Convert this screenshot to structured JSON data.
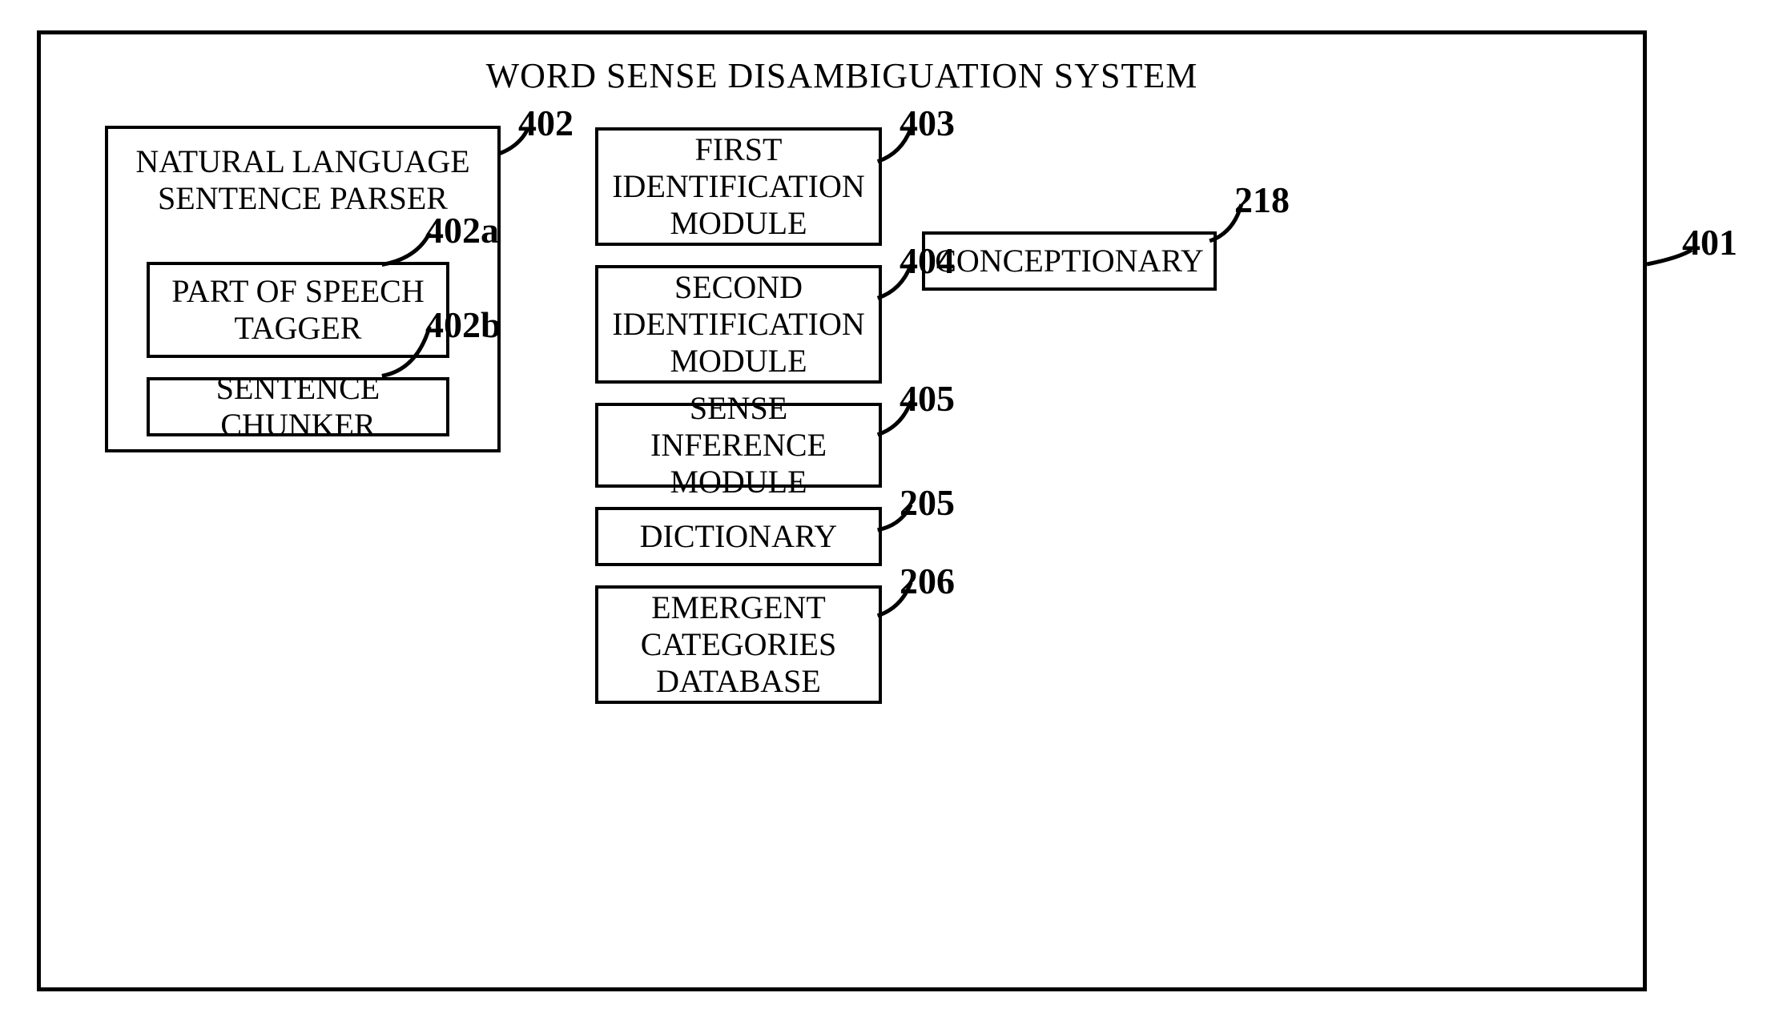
{
  "main_title": "WORD SENSE DISAMBIGUATION SYSTEM",
  "parser": {
    "title_l1": "NATURAL LANGUAGE",
    "title_l2": "SENTENCE PARSER",
    "pos_tagger_l1": "PART OF SPEECH",
    "pos_tagger_l2": "TAGGER",
    "chunker": "SENTENCE CHUNKER"
  },
  "modules": {
    "first_l1": "FIRST",
    "first_l2": "IDENTIFICATION",
    "first_l3": "MODULE",
    "second_l1": "SECOND",
    "second_l2": "IDENTIFICATION",
    "second_l3": "MODULE",
    "sense_l1": "SENSE INFERENCE",
    "sense_l2": "MODULE",
    "dictionary": "DICTIONARY",
    "emergent_l1": "EMERGENT",
    "emergent_l2": "CATEGORIES",
    "emergent_l3": "DATABASE"
  },
  "conceptionary": "CONCEPTIONARY",
  "refs": {
    "r402": "402",
    "r402a": "402a",
    "r402b": "402b",
    "r403": "403",
    "r404": "404",
    "r405": "405",
    "r205": "205",
    "r206": "206",
    "r218": "218",
    "r401": "401"
  }
}
